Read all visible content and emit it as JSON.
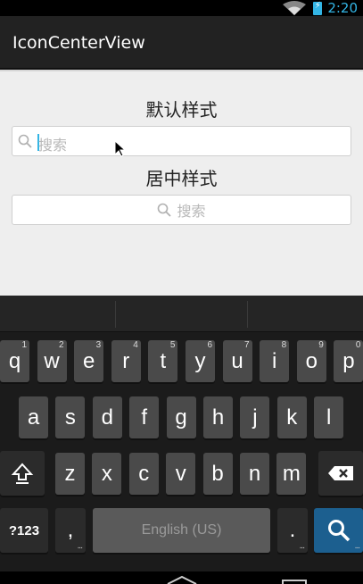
{
  "status": {
    "time": "2:20"
  },
  "app": {
    "title": "IconCenterView"
  },
  "sections": [
    {
      "title": "默认样式",
      "placeholder": "搜索"
    },
    {
      "title": "居中样式",
      "placeholder": "搜索"
    }
  ],
  "keyboard": {
    "row1": [
      {
        "k": "q",
        "h": "1"
      },
      {
        "k": "w",
        "h": "2"
      },
      {
        "k": "e",
        "h": "3"
      },
      {
        "k": "r",
        "h": "4"
      },
      {
        "k": "t",
        "h": "5"
      },
      {
        "k": "y",
        "h": "6"
      },
      {
        "k": "u",
        "h": "7"
      },
      {
        "k": "i",
        "h": "8"
      },
      {
        "k": "o",
        "h": "9"
      },
      {
        "k": "p",
        "h": "0"
      }
    ],
    "row2": [
      "a",
      "s",
      "d",
      "f",
      "g",
      "h",
      "j",
      "k",
      "l"
    ],
    "row3": [
      "z",
      "x",
      "c",
      "v",
      "b",
      "n",
      "m"
    ],
    "symbols_label": "?123",
    "comma": ",",
    "space_label": "English (US)",
    "period": ".",
    "icons": {
      "shift": "shift-icon",
      "backspace": "backspace-icon",
      "enter": "search-icon"
    }
  },
  "colors": {
    "accent": "#33b5e5",
    "action_bar": "#222222",
    "content_bg": "#eeeeee"
  }
}
